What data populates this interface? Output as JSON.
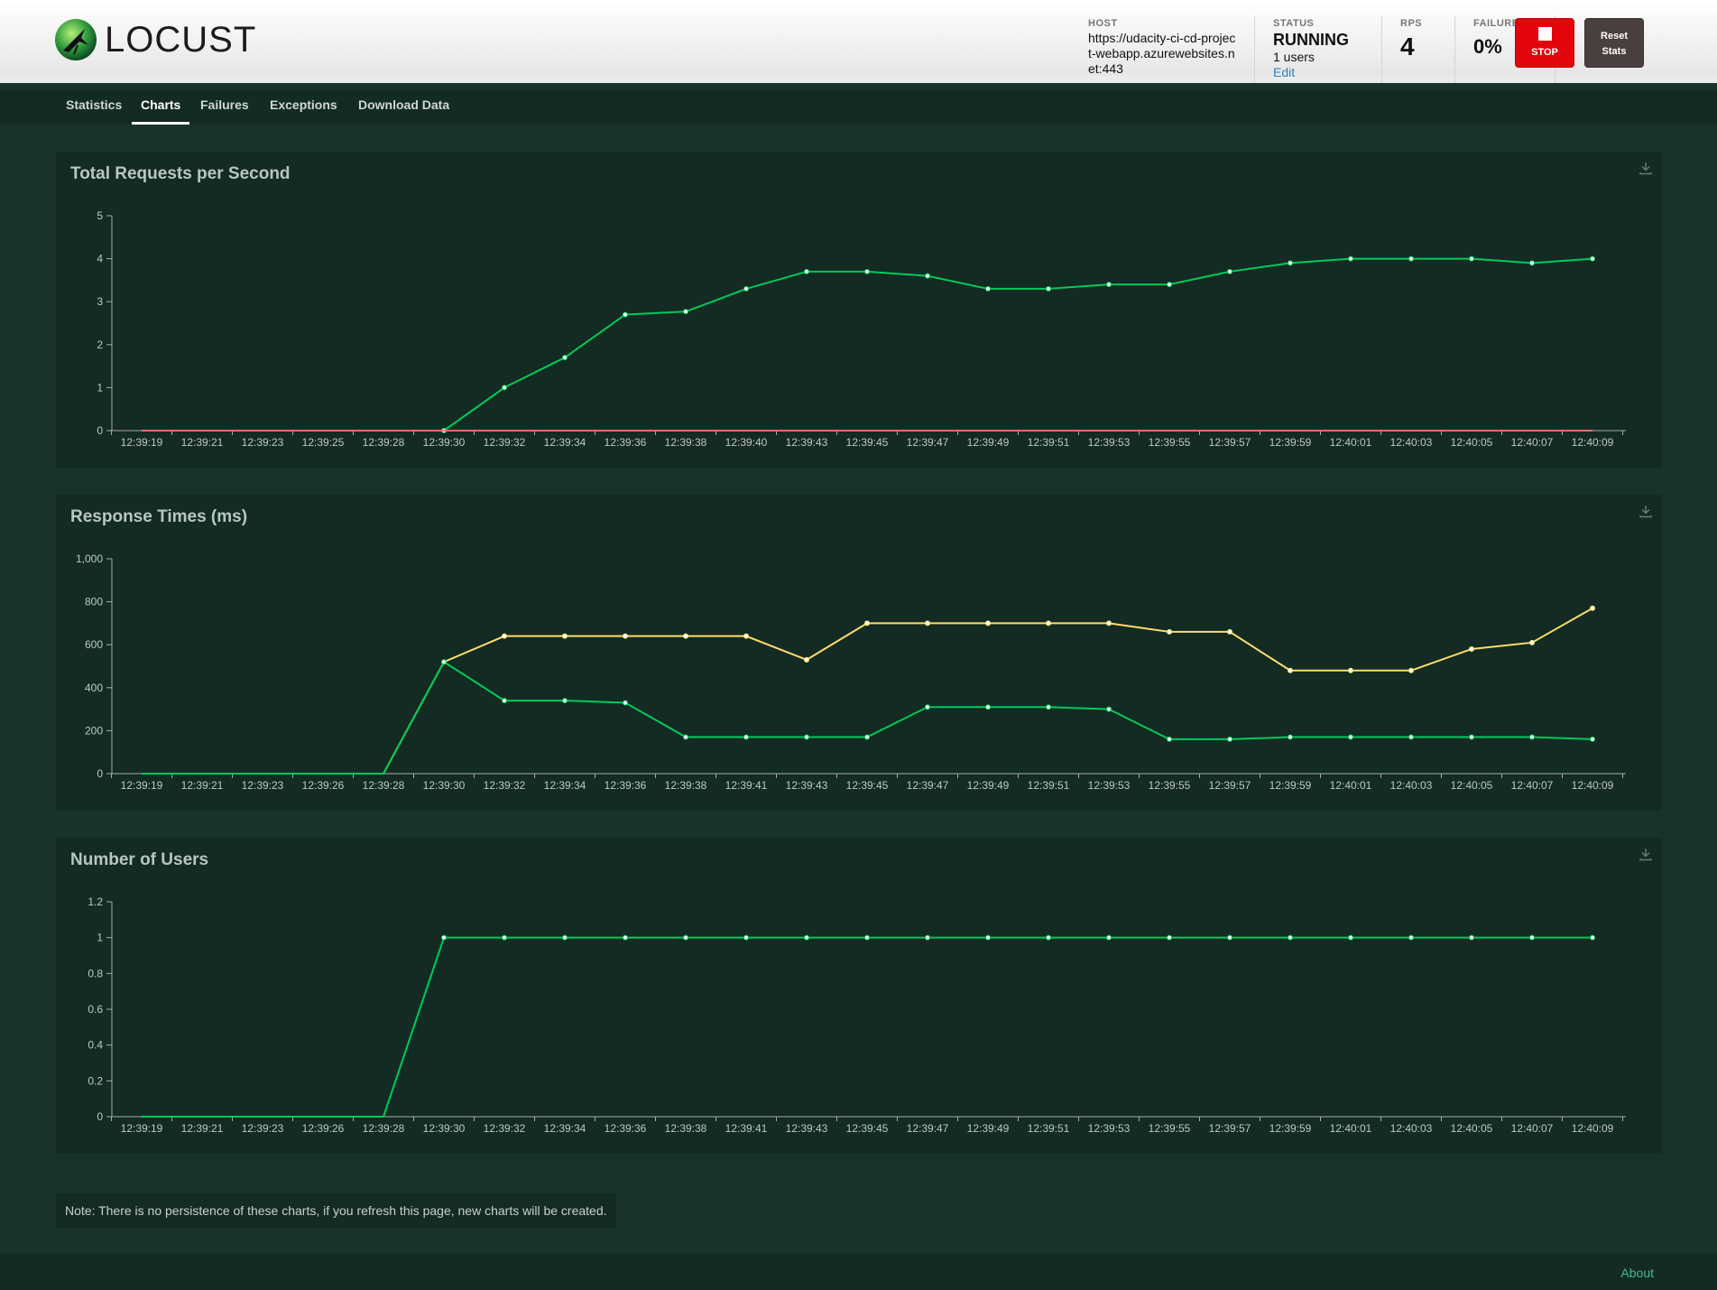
{
  "app": {
    "logo_text": "LOCUST"
  },
  "header": {
    "host_label": "HOST",
    "host_value": "https://udacity-ci-cd-project-webapp.azurewebsites.net:443",
    "status_label": "STATUS",
    "status_value": "RUNNING",
    "status_users": "1 users",
    "status_edit": "Edit",
    "rps_label": "RPS",
    "rps_value": "4",
    "failures_label": "FAILURES",
    "failures_value": "0%",
    "stop_label": "STOP",
    "reset_label": "Reset Stats"
  },
  "nav": {
    "tabs": [
      {
        "label": "Statistics"
      },
      {
        "label": "Charts"
      },
      {
        "label": "Failures"
      },
      {
        "label": "Exceptions"
      },
      {
        "label": "Download Data"
      }
    ],
    "active": "Charts"
  },
  "colors": {
    "green": "#00ca5a",
    "yellow": "#ffdd6b",
    "red": "#ff6d6d",
    "axis": "#aaaaaa",
    "label": "#c0c8c4"
  },
  "chart_data": [
    {
      "type": "line",
      "title": "Total Requests per Second",
      "x": [
        "12:39:19",
        "12:39:21",
        "12:39:23",
        "12:39:25",
        "12:39:28",
        "12:39:30",
        "12:39:32",
        "12:39:34",
        "12:39:36",
        "12:39:38",
        "12:39:40",
        "12:39:43",
        "12:39:45",
        "12:39:47",
        "12:39:49",
        "12:39:51",
        "12:39:53",
        "12:39:55",
        "12:39:57",
        "12:39:59",
        "12:40:01",
        "12:40:03",
        "12:40:05",
        "12:40:07",
        "12:40:09"
      ],
      "yticks": [
        "0",
        "1",
        "2",
        "3",
        "4",
        "5"
      ],
      "ylim": [
        0,
        5
      ],
      "series": [
        {
          "color": "#00ca5a",
          "markers": true,
          "start": 5,
          "values": [
            0,
            0,
            0,
            0,
            0,
            0,
            1.0,
            1.7,
            2.7,
            2.77,
            3.3,
            3.7,
            3.7,
            3.6,
            3.3,
            3.3,
            3.4,
            3.4,
            3.7,
            3.9,
            4.0,
            4.0,
            4.0,
            3.9,
            4.0
          ]
        },
        {
          "color": "#ff6d6d",
          "markers": false,
          "start": 0,
          "values": [
            0,
            0,
            0,
            0,
            0,
            0,
            0,
            0,
            0,
            0,
            0,
            0,
            0,
            0,
            0,
            0,
            0,
            0,
            0,
            0,
            0,
            0,
            0,
            0,
            0
          ]
        }
      ],
      "download_icon": "download-icon"
    },
    {
      "type": "line",
      "title": "Response Times (ms)",
      "x": [
        "12:39:19",
        "12:39:21",
        "12:39:23",
        "12:39:26",
        "12:39:28",
        "12:39:30",
        "12:39:32",
        "12:39:34",
        "12:39:36",
        "12:39:38",
        "12:39:41",
        "12:39:43",
        "12:39:45",
        "12:39:47",
        "12:39:49",
        "12:39:51",
        "12:39:53",
        "12:39:55",
        "12:39:57",
        "12:39:59",
        "12:40:01",
        "12:40:03",
        "12:40:05",
        "12:40:07",
        "12:40:09"
      ],
      "yticks": [
        "0",
        "200",
        "400",
        "600",
        "800",
        "1,000"
      ],
      "ylim": [
        0,
        1000
      ],
      "series": [
        {
          "color": "#ffdd6b",
          "markers": true,
          "start": 5,
          "values": [
            0,
            0,
            0,
            0,
            0,
            520,
            640,
            640,
            640,
            640,
            640,
            530,
            700,
            700,
            700,
            700,
            700,
            660,
            660,
            480,
            480,
            480,
            580,
            610,
            770
          ]
        },
        {
          "color": "#00ca5a",
          "markers": true,
          "start": 5,
          "values": [
            0,
            0,
            0,
            0,
            0,
            520,
            340,
            340,
            330,
            170,
            170,
            170,
            170,
            310,
            310,
            310,
            300,
            160,
            160,
            170,
            170,
            170,
            170,
            170,
            160
          ]
        }
      ],
      "download_icon": "download-icon"
    },
    {
      "type": "line",
      "title": "Number of Users",
      "x": [
        "12:39:19",
        "12:39:21",
        "12:39:23",
        "12:39:26",
        "12:39:28",
        "12:39:30",
        "12:39:32",
        "12:39:34",
        "12:39:36",
        "12:39:38",
        "12:39:41",
        "12:39:43",
        "12:39:45",
        "12:39:47",
        "12:39:49",
        "12:39:51",
        "12:39:53",
        "12:39:55",
        "12:39:57",
        "12:39:59",
        "12:40:01",
        "12:40:03",
        "12:40:05",
        "12:40:07",
        "12:40:09"
      ],
      "yticks": [
        "0",
        "0.2",
        "0.4",
        "0.6",
        "0.8",
        "1",
        "1.2"
      ],
      "ylim": [
        0,
        1.2
      ],
      "series": [
        {
          "color": "#00ca5a",
          "markers": true,
          "start": 5,
          "values": [
            0,
            0,
            0,
            0,
            0,
            1,
            1,
            1,
            1,
            1,
            1,
            1,
            1,
            1,
            1,
            1,
            1,
            1,
            1,
            1,
            1,
            1,
            1,
            1,
            1
          ]
        }
      ],
      "download_icon": "download-icon"
    }
  ],
  "note": "Note: There is no persistence of these charts, if you refresh this page, new charts will be created.",
  "footer": {
    "about": "About"
  }
}
